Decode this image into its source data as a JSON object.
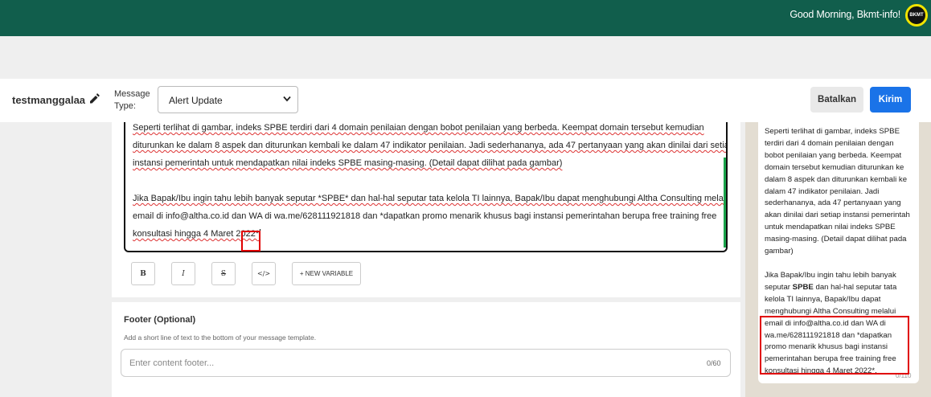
{
  "topbar": {
    "greeting": "Good Morning, Bkmt-info!",
    "logo_text": "BKMT",
    "bg_color": "#115e4c"
  },
  "header": {
    "template_name": "testmanggalaa",
    "edit_icon": "pencil-icon",
    "message_type_label": "Message Type:",
    "message_type_value": "Alert Update",
    "cancel_label": "Batalkan",
    "send_label": "Kirim",
    "accent_color": "#1a73e8"
  },
  "editor": {
    "line1": "Seperti terlihat di gambar, indeks SPBE terdiri dari 4 domain penilaian dengan bobot penilaian yang berbeda. Keempat domain tersebut kemudian",
    "line2": "diturunkan ke dalam 8 aspek dan diturunkan kembali ke dalam 47 indikator penilaian. Jadi sederhananya, ada 47 pertanyaan yang akan dinilai dari setiap",
    "line3": "instansi pemerintah untuk mendapatkan nilai indeks SPBE masing-masing. (Detail  dapat dilihat pada gambar)",
    "line4": "Jika Bapak/Ibu ingin tahu lebih banyak seputar *SPBE* dan hal-hal seputar tata kelola TI lainnya, Bapak/Ibu dapat menghubungi Altha Consulting melalui",
    "line5": "email di info@altha.co.id dan WA di wa.me/628111921818 dan *dapatkan promo menarik khusus bagi instansi pemerintahan berupa free training free",
    "line6": "konsultasi hingga 4 Maret 2022*"
  },
  "toolbar": {
    "bold": "B",
    "italic": "I",
    "strike": "S",
    "code": "</>",
    "new_variable": "+ NEW VARIABLE"
  },
  "footer": {
    "title": "Footer (Optional)",
    "description": "Add a short line of text to the bottom of your message template.",
    "placeholder": "Enter content footer...",
    "counter": "0/60"
  },
  "preview": {
    "para1": "Seperti terlihat di gambar, indeks SPBE terdiri dari 4 domain penilaian dengan bobot penilaian yang berbeda. Keempat domain tersebut kemudian diturunkan ke dalam 8 aspek dan diturunkan kembali ke dalam 47 indikator penilaian. Jadi sederhananya, ada 47 pertanyaan yang akan dinilai dari setiap instansi pemerintah untuk mendapatkan nilai indeks SPBE masing-masing. (Detail  dapat dilihat pada gambar)",
    "para2_before": "Jika Bapak/Ibu ingin tahu lebih banyak seputar ",
    "para2_bold": "SPBE",
    "para2_after": " dan hal-hal seputar tata kelola TI lainnya, Bapak/Ibu dapat menghubungi Altha Consulting melalui email di info@altha.co.id dan WA di wa.me/628111921818 dan *dapatkan promo menarik khusus bagi instansi pemerintahan berupa free training free konsultasi hingga 4 Maret 2022*.",
    "counter": "0/110"
  }
}
